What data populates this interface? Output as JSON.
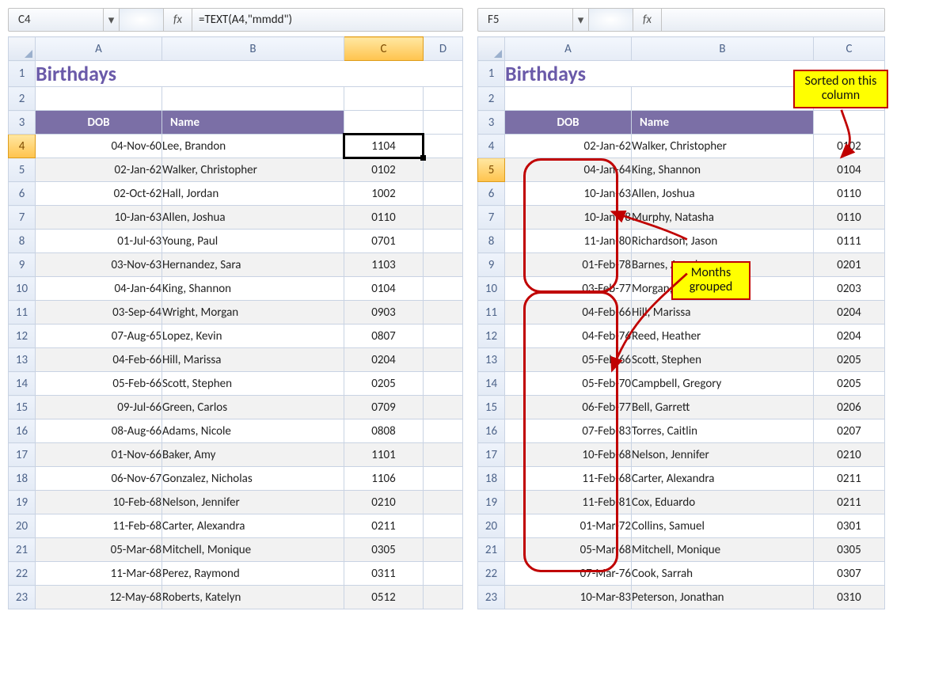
{
  "left": {
    "namebox": "C4",
    "fx": "fx",
    "formula": "=TEXT(A4,\"mmdd\")",
    "cols": [
      "A",
      "B",
      "C",
      "D"
    ],
    "title": "Birthdays",
    "headers": {
      "a": "DOB",
      "b": "Name"
    },
    "selected_row": 4,
    "selected_col": "C",
    "rows": [
      {
        "n": 4,
        "a": "04-Nov-60",
        "b": "Lee, Brandon",
        "c": "1104"
      },
      {
        "n": 5,
        "a": "02-Jan-62",
        "b": "Walker, Christopher",
        "c": "0102"
      },
      {
        "n": 6,
        "a": "02-Oct-62",
        "b": "Hall, Jordan",
        "c": "1002"
      },
      {
        "n": 7,
        "a": "10-Jan-63",
        "b": "Allen, Joshua",
        "c": "0110"
      },
      {
        "n": 8,
        "a": "01-Jul-63",
        "b": "Young, Paul",
        "c": "0701"
      },
      {
        "n": 9,
        "a": "03-Nov-63",
        "b": "Hernandez, Sara",
        "c": "1103"
      },
      {
        "n": 10,
        "a": "04-Jan-64",
        "b": "King, Shannon",
        "c": "0104"
      },
      {
        "n": 11,
        "a": "03-Sep-64",
        "b": "Wright, Morgan",
        "c": "0903"
      },
      {
        "n": 12,
        "a": "07-Aug-65",
        "b": "Lopez, Kevin",
        "c": "0807"
      },
      {
        "n": 13,
        "a": "04-Feb-66",
        "b": "Hill, Marissa",
        "c": "0204"
      },
      {
        "n": 14,
        "a": "05-Feb-66",
        "b": "Scott, Stephen",
        "c": "0205"
      },
      {
        "n": 15,
        "a": "09-Jul-66",
        "b": "Green, Carlos",
        "c": "0709"
      },
      {
        "n": 16,
        "a": "08-Aug-66",
        "b": "Adams, Nicole",
        "c": "0808"
      },
      {
        "n": 17,
        "a": "01-Nov-66",
        "b": "Baker, Amy",
        "c": "1101"
      },
      {
        "n": 18,
        "a": "06-Nov-67",
        "b": "Gonzalez, Nicholas",
        "c": "1106"
      },
      {
        "n": 19,
        "a": "10-Feb-68",
        "b": "Nelson, Jennifer",
        "c": "0210"
      },
      {
        "n": 20,
        "a": "11-Feb-68",
        "b": "Carter, Alexandra",
        "c": "0211"
      },
      {
        "n": 21,
        "a": "05-Mar-68",
        "b": "Mitchell, Monique",
        "c": "0305"
      },
      {
        "n": 22,
        "a": "11-Mar-68",
        "b": "Perez, Raymond",
        "c": "0311"
      },
      {
        "n": 23,
        "a": "12-May-68",
        "b": "Roberts, Katelyn",
        "c": "0512"
      }
    ]
  },
  "right": {
    "namebox": "F5",
    "fx": "fx",
    "formula": "",
    "cols": [
      "A",
      "B",
      "C"
    ],
    "title": "Birthdays",
    "headers": {
      "a": "DOB",
      "b": "Name"
    },
    "selected_row": 5,
    "rows": [
      {
        "n": 4,
        "a": "02-Jan-62",
        "b": "Walker, Christopher",
        "c": "0102"
      },
      {
        "n": 5,
        "a": "04-Jan-64",
        "b": "King, Shannon",
        "c": "0104"
      },
      {
        "n": 6,
        "a": "10-Jan-63",
        "b": "Allen, Joshua",
        "c": "0110"
      },
      {
        "n": 7,
        "a": "10-Jan-78",
        "b": "Murphy, Natasha",
        "c": "0110"
      },
      {
        "n": 8,
        "a": "11-Jan-80",
        "b": "Richardson, Jason",
        "c": "0111"
      },
      {
        "n": 9,
        "a": "01-Feb-78",
        "b": "Barnes, Angela",
        "c": "0201"
      },
      {
        "n": 10,
        "a": "03-Feb-77",
        "b": "Morgan, Steven",
        "c": "0203"
      },
      {
        "n": 11,
        "a": "04-Feb-66",
        "b": "Hill, Marissa",
        "c": "0204"
      },
      {
        "n": 12,
        "a": "04-Feb-76",
        "b": "Reed, Heather",
        "c": "0204"
      },
      {
        "n": 13,
        "a": "05-Feb-66",
        "b": "Scott, Stephen",
        "c": "0205"
      },
      {
        "n": 14,
        "a": "05-Feb-70",
        "b": "Campbell, Gregory",
        "c": "0205"
      },
      {
        "n": 15,
        "a": "06-Feb-77",
        "b": "Bell, Garrett",
        "c": "0206"
      },
      {
        "n": 16,
        "a": "07-Feb-83",
        "b": "Torres, Caitlin",
        "c": "0207"
      },
      {
        "n": 17,
        "a": "10-Feb-68",
        "b": "Nelson, Jennifer",
        "c": "0210"
      },
      {
        "n": 18,
        "a": "11-Feb-68",
        "b": "Carter, Alexandra",
        "c": "0211"
      },
      {
        "n": 19,
        "a": "11-Feb-81",
        "b": "Cox, Eduardo",
        "c": "0211"
      },
      {
        "n": 20,
        "a": "01-Mar-72",
        "b": "Collins, Samuel",
        "c": "0301"
      },
      {
        "n": 21,
        "a": "05-Mar-68",
        "b": "Mitchell, Monique",
        "c": "0305"
      },
      {
        "n": 22,
        "a": "07-Mar-76",
        "b": "Cook, Sarrah",
        "c": "0307"
      },
      {
        "n": 23,
        "a": "10-Mar-83",
        "b": "Peterson, Jonathan",
        "c": "0310"
      }
    ],
    "note_sorted": "Sorted on\nthis column",
    "note_months": "Months\ngrouped"
  }
}
